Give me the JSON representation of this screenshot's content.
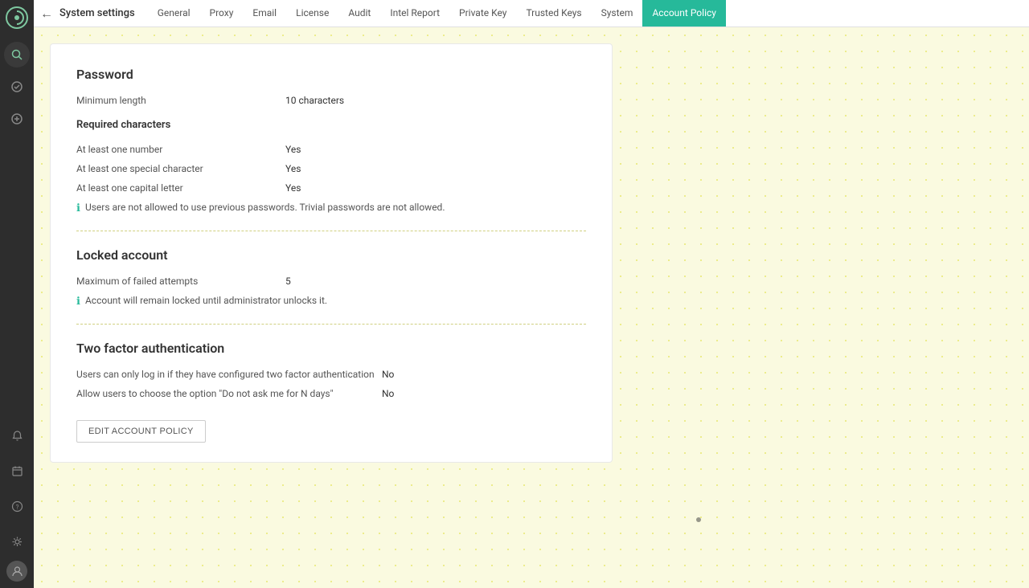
{
  "sidebar": {
    "icons": [
      {
        "name": "logo-icon",
        "symbol": "⟳"
      },
      {
        "name": "search-icon",
        "symbol": "🔍"
      },
      {
        "name": "check-icon",
        "symbol": "✓"
      },
      {
        "name": "plus-icon",
        "symbol": "+"
      },
      {
        "name": "bell-icon",
        "symbol": "🔔"
      },
      {
        "name": "calendar-icon",
        "symbol": "📅"
      },
      {
        "name": "help-icon",
        "symbol": "?"
      },
      {
        "name": "settings-icon",
        "symbol": "⚙"
      },
      {
        "name": "user-icon",
        "symbol": "👤"
      }
    ]
  },
  "header": {
    "back_label": "←",
    "title": "System settings",
    "tabs": [
      {
        "id": "general",
        "label": "General"
      },
      {
        "id": "proxy",
        "label": "Proxy"
      },
      {
        "id": "email",
        "label": "Email"
      },
      {
        "id": "license",
        "label": "License"
      },
      {
        "id": "audit",
        "label": "Audit"
      },
      {
        "id": "intel_report",
        "label": "Intel Report"
      },
      {
        "id": "private_key",
        "label": "Private Key"
      },
      {
        "id": "trusted_keys",
        "label": "Trusted Keys"
      },
      {
        "id": "system",
        "label": "System"
      },
      {
        "id": "account_policy",
        "label": "Account Policy",
        "active": true
      }
    ]
  },
  "content": {
    "password_section": {
      "title": "Password",
      "minimum_length_label": "Minimum length",
      "minimum_length_value": "10 characters",
      "required_chars_title": "Required characters",
      "required_chars": [
        {
          "label": "At least one number",
          "value": "Yes"
        },
        {
          "label": "At least one special character",
          "value": "Yes"
        },
        {
          "label": "At least one capital letter",
          "value": "Yes"
        }
      ],
      "info_text": "Users are not allowed to use previous passwords. Trivial passwords are not allowed."
    },
    "locked_account_section": {
      "title": "Locked account",
      "max_failed_label": "Maximum of failed attempts",
      "max_failed_value": "5",
      "info_text": "Account will remain locked until administrator unlocks it."
    },
    "two_factor_section": {
      "title": "Two factor authentication",
      "fields": [
        {
          "label": "Users can only log in if they have configured two factor authentication",
          "value": "No"
        },
        {
          "label": "Allow users to choose the option \"Do not ask me for N days\"",
          "value": "No"
        }
      ]
    },
    "edit_button_label": "EDIT ACCOUNT POLICY"
  }
}
